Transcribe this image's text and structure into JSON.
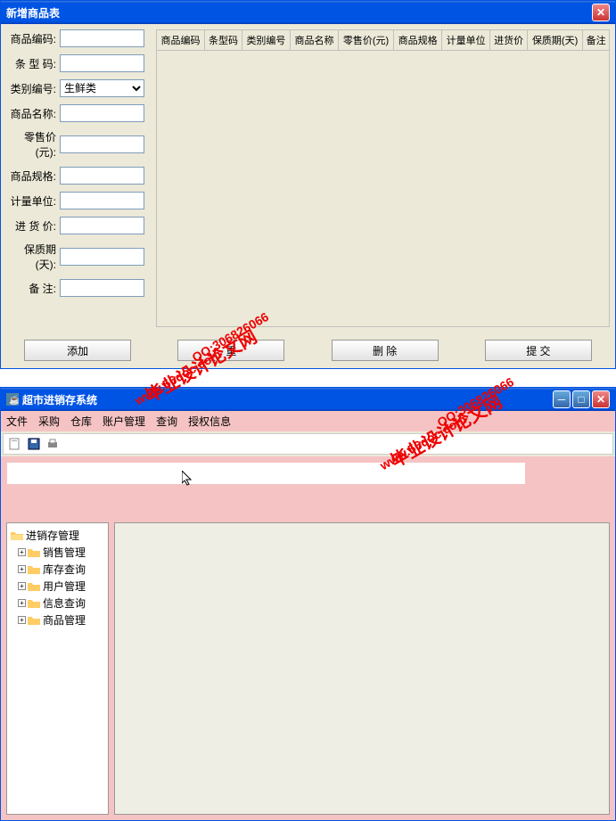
{
  "window1": {
    "title": "新增商品表",
    "form": {
      "labels": {
        "code": "商品编码:",
        "barcode": "条 型 码:",
        "category": "类别编号:",
        "name": "商品名称:",
        "price": "零售价(元):",
        "spec": "商品规格:",
        "unit": "计量单位:",
        "purchase": "进 货 价:",
        "shelf": "保质期(天):",
        "remark": "备  注:"
      },
      "category_value": "生鲜类"
    },
    "table_headers": [
      "商品编码",
      "条型码",
      "类别编号",
      "商品名称",
      "零售价(元)",
      "商品规格",
      "计量单位",
      "进货价",
      "保质期(天)",
      "备注"
    ],
    "buttons": {
      "add": "添加",
      "reset": "重",
      "delete": "删 除",
      "submit": "提 交"
    }
  },
  "window2": {
    "title": "超市进销存系统",
    "menu": [
      "文件",
      "采购",
      "仓库",
      "账户管理",
      "查询",
      "授权信息"
    ],
    "tree": {
      "root": "进销存管理",
      "children": [
        "销售管理",
        "库存查询",
        "用户管理",
        "信息查询",
        "商品管理"
      ]
    }
  },
  "watermark": {
    "url": "www.56doc.com",
    "qq": "QQ:306826066",
    "cn": "毕业设计论文网"
  }
}
